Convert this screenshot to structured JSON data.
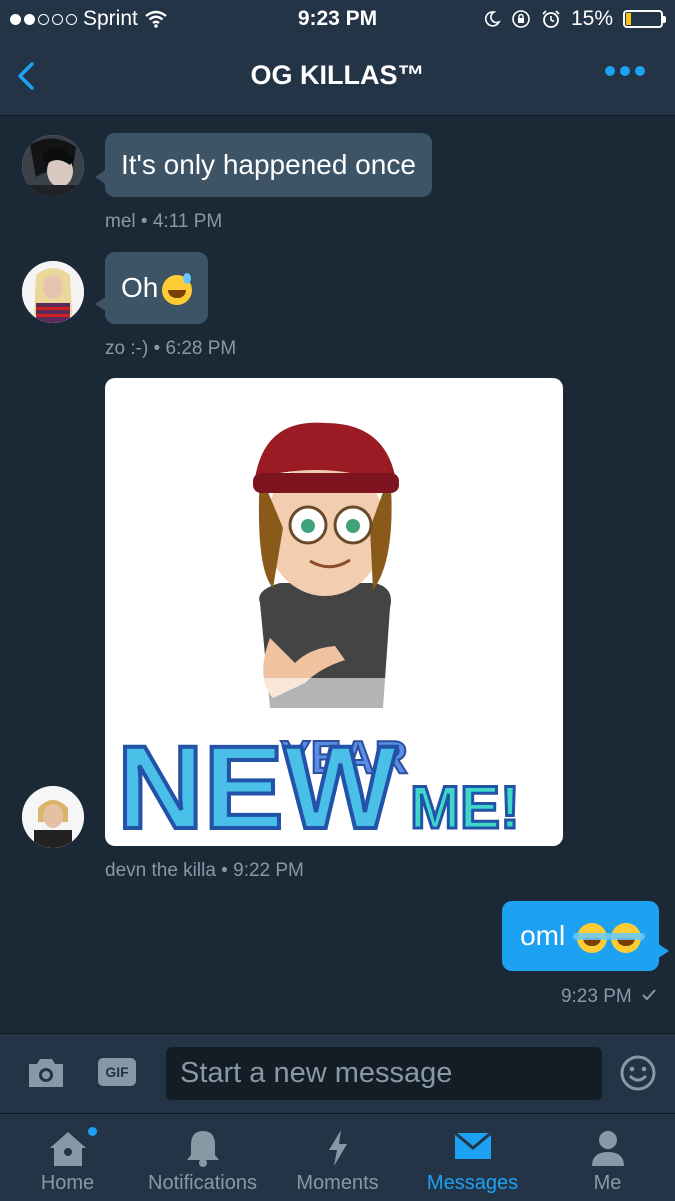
{
  "status": {
    "carrier": "Sprint",
    "time": "9:23 PM",
    "battery": "15%",
    "battery_level": 0.15
  },
  "header": {
    "title": "OG KILLAS™"
  },
  "messages": [
    {
      "text": "It's only happened once",
      "sender": "mel",
      "time": "4:11 PM"
    },
    {
      "text": "Oh",
      "sender": "zo :-)",
      "time": "6:28 PM"
    },
    {
      "sticker_top": "YEAR",
      "sticker_big": "NEW",
      "sticker_bottom": "ME!",
      "sender": "devn the killa",
      "time": "9:22 PM"
    },
    {
      "text": "oml",
      "time": "9:23 PM"
    }
  ],
  "composer": {
    "placeholder": "Start a new message",
    "gif_label": "GIF"
  },
  "tabs": [
    {
      "label": "Home"
    },
    {
      "label": "Notifications"
    },
    {
      "label": "Moments"
    },
    {
      "label": "Messages"
    },
    {
      "label": "Me"
    }
  ],
  "colors": {
    "accent": "#1da1f2",
    "background": "#1b2836",
    "bar": "#243447",
    "bubble": "#3d5366",
    "muted": "#8899a6"
  }
}
